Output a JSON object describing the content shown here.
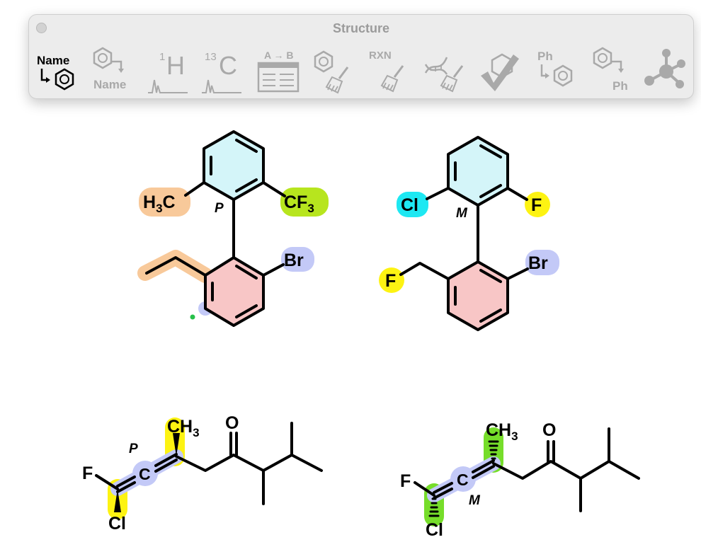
{
  "window": {
    "title": "Structure"
  },
  "toolbar": {
    "name_to_struct": {
      "label": "Name"
    },
    "struct_to_name": {
      "label": "Name"
    },
    "h1_nmr": {
      "sup": "1",
      "letter": "H"
    },
    "c13_nmr": {
      "sup": "13",
      "letter": "C"
    },
    "analysis": {
      "label": "A → B"
    },
    "clean_reaction": {
      "label": "RXN"
    },
    "expand_label": {
      "label": "Ph"
    },
    "contract_label": {
      "label": "Ph"
    }
  },
  "molecules": {
    "m1": {
      "left_sub": {
        "main": "H",
        "sub": "3",
        "tail": "C"
      },
      "right_sub": {
        "main": "CF",
        "sub": "3"
      },
      "stereo": "P",
      "halogen": "Br"
    },
    "m2": {
      "left_sub": "Cl",
      "right_sub": "F",
      "stereo": "M",
      "halogen": "Br",
      "side_atom": "F"
    },
    "m3": {
      "methyl": {
        "main": "CH",
        "sub": "3"
      },
      "oxygen": "O",
      "fluorine": "F",
      "chlorine": "Cl",
      "allene_c": "C",
      "stereo": "P"
    },
    "m4": {
      "methyl": {
        "main": "CH",
        "sub": "3"
      },
      "oxygen": "O",
      "fluorine": "F",
      "chlorine": "Cl",
      "allene_c": "C",
      "stereo": "M"
    }
  },
  "colors": {
    "orange_highlight": "#f8c99a",
    "green_highlight": "#b7e51e",
    "lavender_highlight": "#c3c9f7",
    "cyan_highlight": "#1ee8f2",
    "yellow_highlight": "#fdf312",
    "bright_green_highlight": "#76dd2a",
    "ring_cyan_fill": "#d4f5f9",
    "ring_pink_fill": "#f8c6c6",
    "bond": "#000000",
    "toolbar_icon": "#a9a9a9"
  }
}
